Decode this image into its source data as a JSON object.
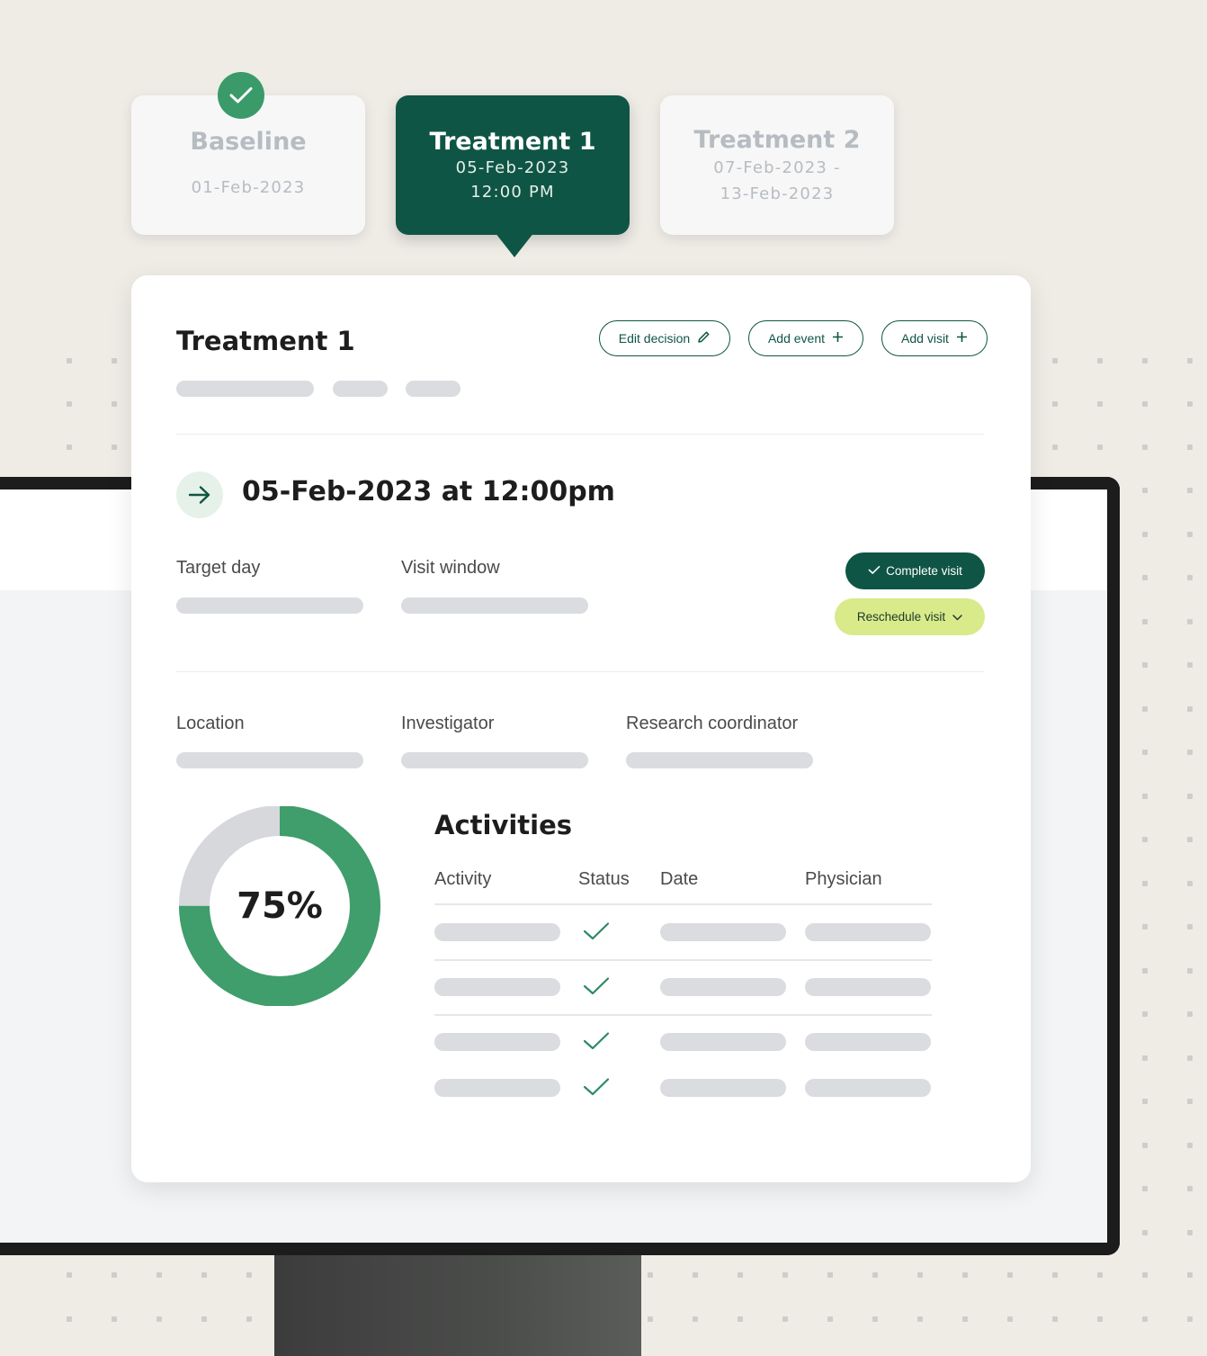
{
  "steps": [
    {
      "title": "Baseline",
      "date": "01-Feb-2023",
      "state": "completed"
    },
    {
      "title": "Treatment 1",
      "date_line1": "05-Feb-2023",
      "date_line2": "12:00 PM",
      "state": "active"
    },
    {
      "title": "Treatment 2",
      "date_line1": "07-Feb-2023 -",
      "date_line2": "13-Feb-2023",
      "state": "upcoming"
    }
  ],
  "card": {
    "title": "Treatment 1",
    "actions": {
      "edit_decision": "Edit decision",
      "add_event": "Add event",
      "add_visit": "Add visit"
    },
    "datetime": "05-Feb-2023 at 12:00pm",
    "fields": {
      "target_day": "Target day",
      "visit_window": "Visit window",
      "location": "Location",
      "investigator": "Investigator",
      "research_coordinator": "Research coordinator"
    },
    "buttons": {
      "complete_visit": "Complete visit",
      "reschedule_visit": "Reschedule visit"
    },
    "progress": {
      "label": "75%",
      "value": 0.75
    },
    "activities": {
      "title": "Activities",
      "columns": [
        "Activity",
        "Status",
        "Date",
        "Physician"
      ],
      "rows": [
        {
          "status": "complete"
        },
        {
          "status": "complete"
        },
        {
          "status": "complete"
        },
        {
          "status": "complete"
        }
      ]
    }
  },
  "colors": {
    "brand_dark_green": "#0f5545",
    "success_green": "#3a9a6a",
    "donut_green": "#3f9e6b",
    "reschedule_lime": "#d8ea8a",
    "background": "#efece6"
  },
  "icons": [
    "check-icon",
    "pencil-icon",
    "plus-icon",
    "arrow-right-icon",
    "chevron-down-icon"
  ]
}
